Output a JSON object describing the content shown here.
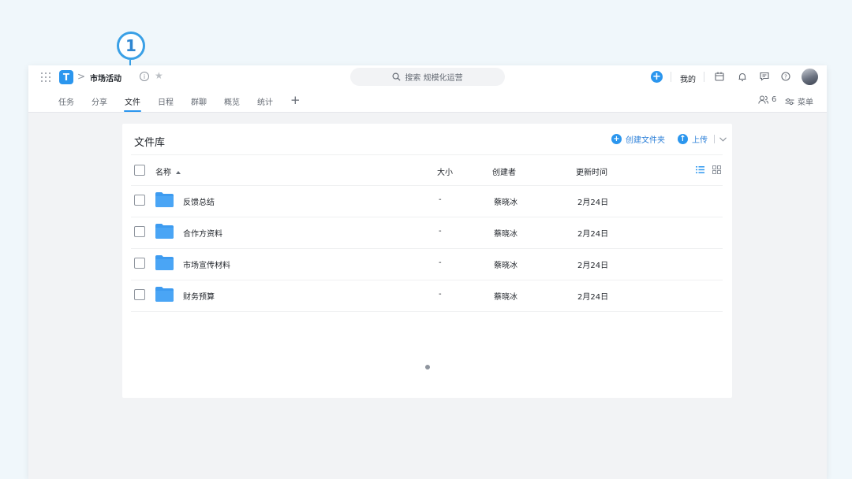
{
  "callout": {
    "number": "1"
  },
  "topbar": {
    "logo_letter": "T",
    "breadcrumb_sep": ">",
    "project_name": "市场活动",
    "search_placeholder": "搜索 规模化运营",
    "mine_label": "我的"
  },
  "tabs": {
    "items": [
      "任务",
      "分享",
      "文件",
      "日程",
      "群聊",
      "概览",
      "统计"
    ],
    "active": "文件",
    "plus": "+",
    "member_count": "6",
    "menu_label": "菜单"
  },
  "library": {
    "title": "文件库",
    "create_folder": "创建文件夹",
    "upload": "上传",
    "columns": {
      "name": "名称",
      "size": "大小",
      "creator": "创建者",
      "updated": "更新时间"
    },
    "rows": [
      {
        "name": "反馈总结",
        "size": "-",
        "creator": "蔡晓冰",
        "updated": "2月24日"
      },
      {
        "name": "合作方资料",
        "size": "-",
        "creator": "蔡晓冰",
        "updated": "2月24日"
      },
      {
        "name": "市场宣传材料",
        "size": "-",
        "creator": "蔡晓冰",
        "updated": "2月24日"
      },
      {
        "name": "财务预算",
        "size": "-",
        "creator": "蔡晓冰",
        "updated": "2月24日"
      }
    ]
  },
  "colors": {
    "accent": "#2b96ee",
    "callout": "#3aa0e6",
    "folder": "#3d9bf0"
  },
  "icons": [
    "apps-grid-icon",
    "app-logo-icon",
    "info-icon",
    "star-icon",
    "search-icon",
    "plus-icon",
    "calendar-icon",
    "bell-icon",
    "message-icon",
    "help-icon",
    "members-icon",
    "menu-settings-icon",
    "list-view-icon",
    "grid-view-icon",
    "folder-icon",
    "upload-icon",
    "chevron-down-icon"
  ]
}
